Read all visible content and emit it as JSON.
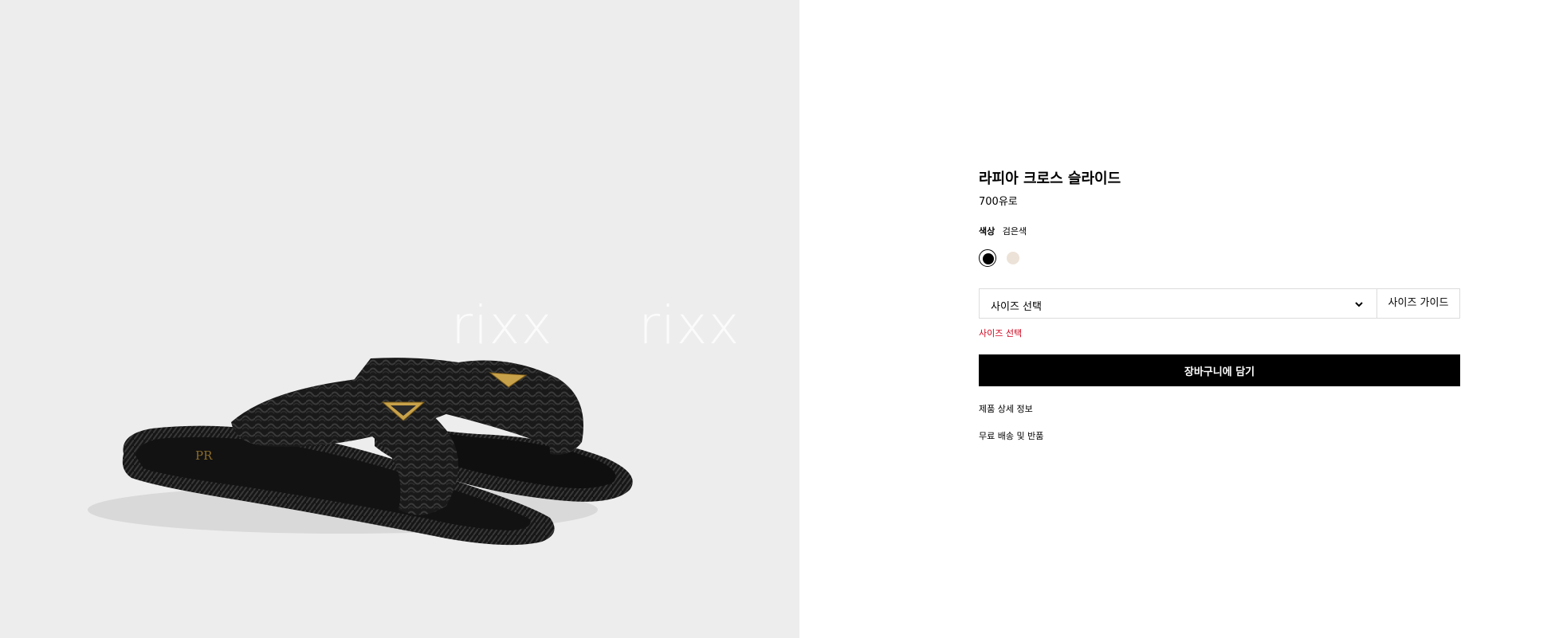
{
  "gallery": {
    "image": "black-raffia-crisscross-slide-sandal",
    "watermarks": [
      "rixx",
      "rixx"
    ],
    "insole_text": "PR"
  },
  "product": {
    "title": "라피아 크로스 슬라이드",
    "price": "700유로",
    "color_label": "색상",
    "color_value": "검은색",
    "swatches": [
      {
        "name": "black",
        "color": "#000000",
        "selected": true
      },
      {
        "name": "beige",
        "color": "#ece2d7",
        "selected": false
      }
    ],
    "size_select_label": "사이즈 선택",
    "size_guide_label": "사이즈 가이드",
    "size_error": "사이즈 선택",
    "error_color": "#d0021b",
    "add_to_cart_label": "장바구니에 담기",
    "links": [
      "제품 상세 정보",
      "무료 배송 및 반품"
    ]
  }
}
